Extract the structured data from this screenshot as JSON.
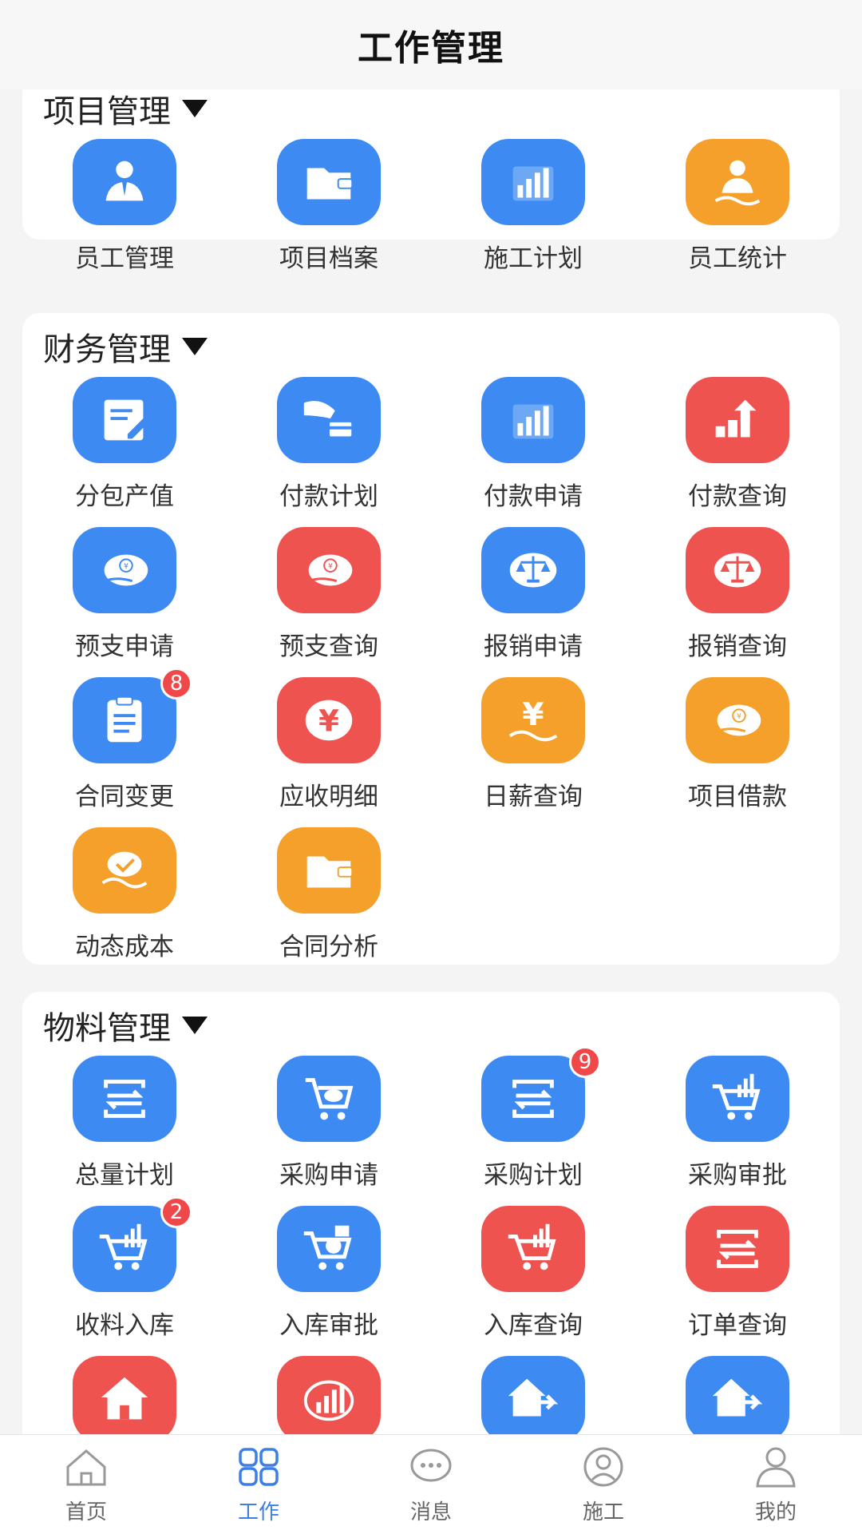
{
  "header": {
    "title": "工作管理"
  },
  "colors": {
    "blue": "#3d8bf2",
    "orange": "#f5a02b",
    "red": "#ef5350",
    "active_tab": "#3d7fe6"
  },
  "sections": [
    {
      "title": "项目管理",
      "items": [
        {
          "label": "员工管理",
          "color": "blue",
          "icon": "person-tie-icon"
        },
        {
          "label": "项目档案",
          "color": "blue",
          "icon": "folder-icon"
        },
        {
          "label": "施工计划",
          "color": "blue",
          "icon": "bar-chart-icon"
        },
        {
          "label": "员工统计",
          "color": "orange",
          "icon": "person-stats-icon"
        }
      ]
    },
    {
      "title": "财务管理",
      "items": [
        {
          "label": "分包产值",
          "color": "blue",
          "icon": "edit-icon"
        },
        {
          "label": "付款计划",
          "color": "blue",
          "icon": "card-payment-icon"
        },
        {
          "label": "付款申请",
          "color": "blue",
          "icon": "bar-chart-icon"
        },
        {
          "label": "付款查询",
          "color": "red",
          "icon": "coins-growth-icon"
        },
        {
          "label": "预支申请",
          "color": "blue",
          "icon": "hand-yen-icon"
        },
        {
          "label": "预支查询",
          "color": "red",
          "icon": "hand-yen-icon"
        },
        {
          "label": "报销申请",
          "color": "blue",
          "icon": "balance-scale-icon"
        },
        {
          "label": "报销查询",
          "color": "red",
          "icon": "balance-scale-icon"
        },
        {
          "label": "合同变更",
          "color": "blue",
          "icon": "clipboard-icon",
          "badge": "8"
        },
        {
          "label": "应收明细",
          "color": "red",
          "icon": "yen-icon"
        },
        {
          "label": "日薪查询",
          "color": "orange",
          "icon": "yen-wave-icon"
        },
        {
          "label": "项目借款",
          "color": "orange",
          "icon": "hand-yen-icon"
        },
        {
          "label": "动态成本",
          "color": "orange",
          "icon": "check-wave-icon"
        },
        {
          "label": "合同分析",
          "color": "orange",
          "icon": "folder-icon"
        }
      ]
    },
    {
      "title": "物料管理",
      "items": [
        {
          "label": "总量计划",
          "color": "blue",
          "icon": "transfer-icon"
        },
        {
          "label": "采购申请",
          "color": "blue",
          "icon": "cart-icon"
        },
        {
          "label": "采购计划",
          "color": "blue",
          "icon": "transfer-icon",
          "badge": "9"
        },
        {
          "label": "采购审批",
          "color": "blue",
          "icon": "cart-chart-icon"
        },
        {
          "label": "收料入库",
          "color": "blue",
          "icon": "cart-chart-icon",
          "badge": "2"
        },
        {
          "label": "入库审批",
          "color": "blue",
          "icon": "cart-box-icon"
        },
        {
          "label": "入库查询",
          "color": "red",
          "icon": "cart-chart-icon"
        },
        {
          "label": "订单查询",
          "color": "red",
          "icon": "transfer-icon"
        },
        {
          "label": "",
          "color": "red",
          "icon": "house-icon"
        },
        {
          "label": "",
          "color": "red",
          "icon": "chart-circle-icon"
        },
        {
          "label": "",
          "color": "blue",
          "icon": "house-arrow-icon"
        },
        {
          "label": "",
          "color": "blue",
          "icon": "house-arrow-icon"
        }
      ]
    }
  ],
  "tabs": [
    {
      "label": "首页",
      "icon": "home-icon",
      "active": false
    },
    {
      "label": "工作",
      "icon": "grid-icon",
      "active": true
    },
    {
      "label": "消息",
      "icon": "chat-icon",
      "active": false
    },
    {
      "label": "施工",
      "icon": "worker-icon",
      "active": false
    },
    {
      "label": "我的",
      "icon": "user-icon",
      "active": false
    }
  ]
}
